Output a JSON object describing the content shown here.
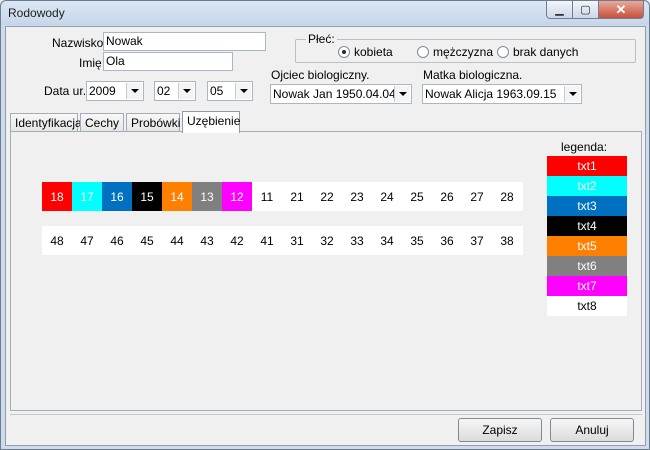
{
  "window": {
    "title": "Rodowody"
  },
  "form": {
    "surname_label": "Nazwisko",
    "surname_value": "Nowak",
    "name_label": "Imię",
    "name_value": "Ola",
    "dob_label": "Data ur.",
    "dob_year": "2009",
    "dob_month": "02",
    "dob_day": "05",
    "sex_label": "Płeć:",
    "sex_options": [
      "kobieta",
      "mężczyzna",
      "brak danych"
    ],
    "sex_selected": "kobieta",
    "father_label": "Ojciec biologiczny.",
    "father_value": "Nowak Jan 1950.04.04",
    "mother_label": "Matka biologiczna.",
    "mother_value": "Nowak Alicja 1963.09.15"
  },
  "tabs": [
    "Identyfikacja",
    "Cechy",
    "Probówki",
    "Uzębienie"
  ],
  "active_tab": "Uzębienie",
  "teeth": {
    "upper": [
      {
        "n": "18",
        "legend": "txt1"
      },
      {
        "n": "17",
        "legend": "txt2"
      },
      {
        "n": "16",
        "legend": "txt3"
      },
      {
        "n": "15",
        "legend": "txt4"
      },
      {
        "n": "14",
        "legend": "txt5"
      },
      {
        "n": "13",
        "legend": "txt6"
      },
      {
        "n": "12",
        "legend": "txt7"
      },
      {
        "n": "11",
        "legend": "txt8"
      },
      {
        "n": "21",
        "legend": "txt8"
      },
      {
        "n": "22",
        "legend": "txt8"
      },
      {
        "n": "23",
        "legend": "txt8"
      },
      {
        "n": "24",
        "legend": "txt8"
      },
      {
        "n": "25",
        "legend": "txt8"
      },
      {
        "n": "26",
        "legend": "txt8"
      },
      {
        "n": "27",
        "legend": "txt8"
      },
      {
        "n": "28",
        "legend": "txt8"
      }
    ],
    "lower": [
      "48",
      "47",
      "46",
      "45",
      "44",
      "43",
      "42",
      "41",
      "31",
      "32",
      "33",
      "34",
      "35",
      "36",
      "37",
      "38"
    ]
  },
  "legend": {
    "title": "legenda:",
    "items": [
      {
        "label": "txt1",
        "color": "#ff0000",
        "text_color": "#ffffff"
      },
      {
        "label": "txt2",
        "color": "#00ffff",
        "text_color": "#ffffff"
      },
      {
        "label": "txt3",
        "color": "#0070c0",
        "text_color": "#ffffff"
      },
      {
        "label": "txt4",
        "color": "#000000",
        "text_color": "#ffffff"
      },
      {
        "label": "txt5",
        "color": "#ff8000",
        "text_color": "#ffffff"
      },
      {
        "label": "txt6",
        "color": "#808080",
        "text_color": "#ffffff"
      },
      {
        "label": "txt7",
        "color": "#ff00ff",
        "text_color": "#ffffff"
      },
      {
        "label": "txt8",
        "color": "#ffffff",
        "text_color": "#000000"
      }
    ]
  },
  "buttons": {
    "save": "Zapisz",
    "cancel": "Anuluj"
  }
}
